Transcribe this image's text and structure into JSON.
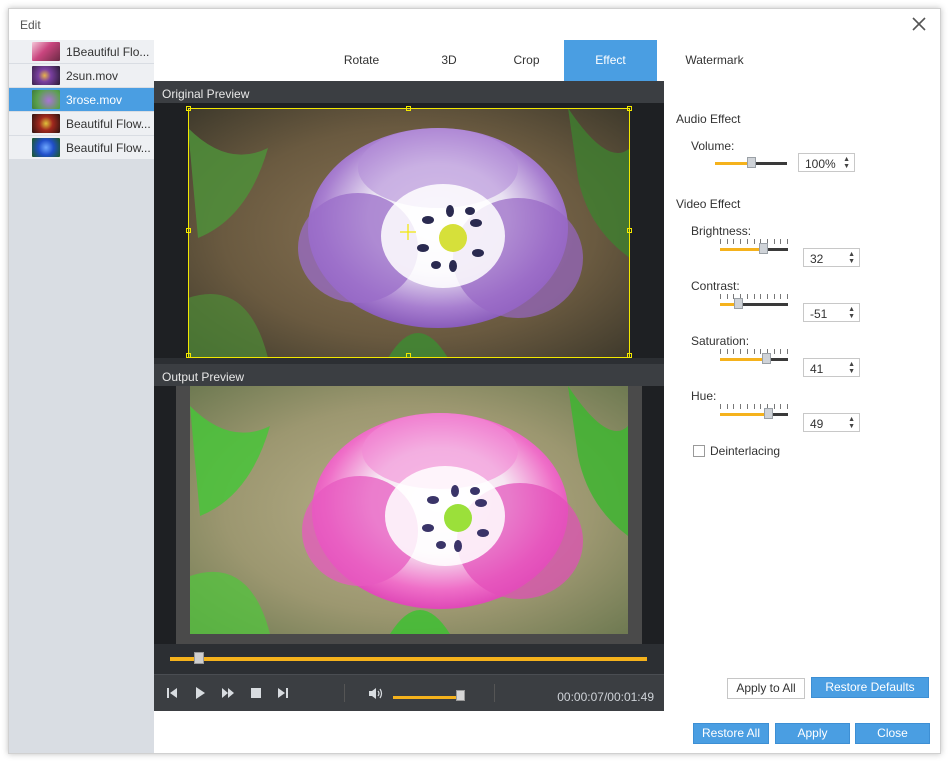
{
  "window": {
    "title": "Edit"
  },
  "files": [
    {
      "name": "1Beautiful Flo...",
      "selected": false
    },
    {
      "name": "2sun.mov",
      "selected": false
    },
    {
      "name": "3rose.mov",
      "selected": true
    },
    {
      "name": "Beautiful Flow...",
      "selected": false
    },
    {
      "name": "Beautiful Flow...",
      "selected": false
    }
  ],
  "tabs": [
    {
      "label": "Rotate",
      "active": false
    },
    {
      "label": "3D",
      "active": false
    },
    {
      "label": "Crop",
      "active": false
    },
    {
      "label": "Effect",
      "active": true
    },
    {
      "label": "Watermark",
      "active": false
    }
  ],
  "preview": {
    "original_label": "Original Preview",
    "output_label": "Output Preview",
    "seek_progress": 0.05,
    "volume_level": 0.9,
    "timecode": "00:00:07/00:01:49"
  },
  "effects": {
    "audio_title": "Audio Effect",
    "volume_label": "Volume:",
    "volume_value": "100%",
    "volume_level": 0.5,
    "video_title": "Video Effect",
    "brightness_label": "Brightness:",
    "brightness_value": "32",
    "brightness": 32,
    "contrast_label": "Contrast:",
    "contrast_value": "-51",
    "contrast": -51,
    "saturation_label": "Saturation:",
    "saturation_value": "41",
    "saturation": 41,
    "hue_label": "Hue:",
    "hue_value": "49",
    "hue": 49,
    "deinterlacing_label": "Deinterlacing",
    "deinterlacing_checked": false
  },
  "buttons": {
    "apply_to_all": "Apply to All",
    "restore_defaults": "Restore Defaults",
    "restore_all": "Restore All",
    "apply": "Apply",
    "close": "Close"
  },
  "colors": {
    "accent": "#4a9ee2",
    "slider_fill": "#f5b21c",
    "crop_border": "#f2e800",
    "dark_bg": "#2c2f33"
  }
}
